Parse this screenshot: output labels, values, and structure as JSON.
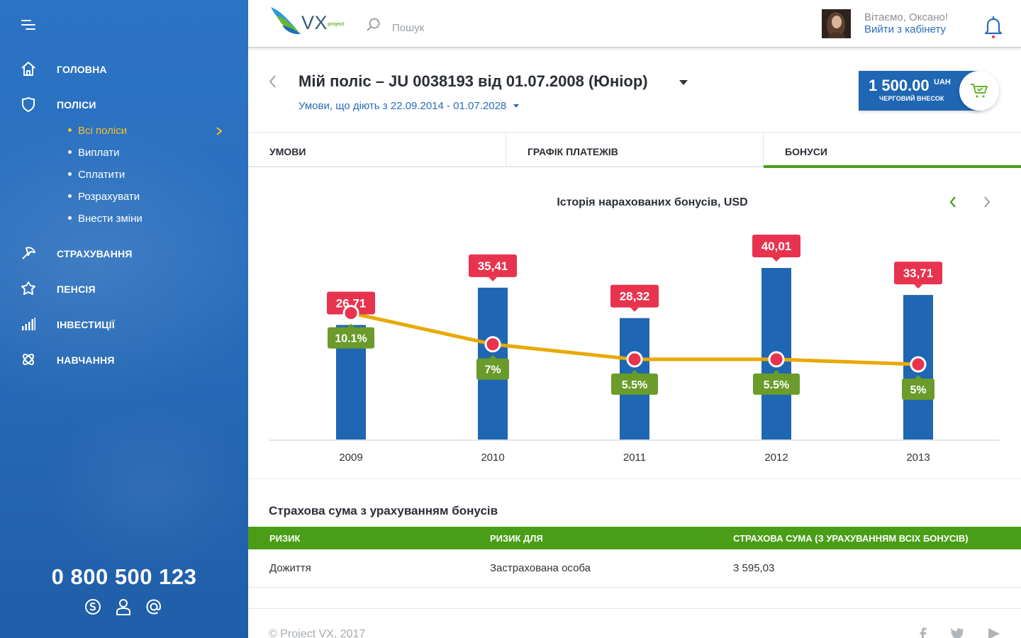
{
  "sidebar": {
    "nav": [
      {
        "label": "ГОЛОВНА",
        "icon": "home-icon"
      },
      {
        "label": "ПОЛІСИ",
        "icon": "shield-icon"
      },
      {
        "label": "СТРАХУВАННЯ",
        "icon": "umbrella-icon"
      },
      {
        "label": "ПЕНСІЯ",
        "icon": "flower-icon"
      },
      {
        "label": "ІНВЕСТИЦІЇ",
        "icon": "bar-chart-icon"
      },
      {
        "label": "НАВЧАННЯ",
        "icon": "atom-icon"
      }
    ],
    "sub_items": [
      "Всі поліси",
      "Виплати",
      "Сплатити",
      "Розрахувати",
      "Внести зміни"
    ],
    "active_sub": "Всі поліси",
    "phone": "0 800 500 123",
    "contact_icons": [
      "skype-icon",
      "user-icon",
      "at-icon"
    ]
  },
  "header": {
    "logo_text": "VX",
    "logo_sub": "project",
    "search_placeholder": "Пошук",
    "greeting": "Вітаємо, Оксано!",
    "logout": "Вийти з кабінету"
  },
  "policy": {
    "title": "Мій поліс – JU 0038193 від 01.07.2008 (Юніор)",
    "conditions": "Умови, що діють з 22.09.2014 - 01.07.2028",
    "payment_amount": "1 500.00",
    "payment_currency": "UAH",
    "payment_label": "ЧЕРГОВИЙ ВНЕСОК"
  },
  "tabs": [
    "УМОВИ",
    "ГРАФІК ПЛАТЕЖІВ",
    "БОНУСИ"
  ],
  "active_tab": "БОНУСИ",
  "chart_data": {
    "type": "bar",
    "title": "Історія нарахованих бонусів, USD",
    "categories": [
      "2009",
      "2010",
      "2011",
      "2012",
      "2013"
    ],
    "series": [
      {
        "values": [
          26.71,
          35.41,
          28.32,
          40.01,
          33.71
        ],
        "labels": [
          "26,71",
          "35,41",
          "28,32",
          "40,01",
          "33,71"
        ]
      },
      {
        "values": [
          10.1,
          7,
          5.5,
          5.5,
          5
        ],
        "labels": [
          "10.1%",
          "7%",
          "5.5%",
          "5.5%",
          "5%"
        ]
      }
    ],
    "ylim": [
      0,
      42
    ],
    "grid": false,
    "colors": {
      "bar": "#1f66b3",
      "line": "#e8a900",
      "bar_label": "#e8334e",
      "rate_label": "#6a9b2b",
      "point": "#e8334e"
    }
  },
  "table": {
    "title": "Страхова сума з урахуванням бонусів",
    "headers": [
      "РИЗИК",
      "РИЗИК ДЛЯ",
      "СТРАХОВА СУМА (З УРАХУВАННЯМ ВСІХ БОНУСІВ)"
    ],
    "rows": [
      [
        "Дожиття",
        "Застрахована особа",
        "3 595,03"
      ]
    ]
  },
  "footer": {
    "copyright": "© Project VX, 2017",
    "social": [
      "facebook-icon",
      "twitter-icon",
      "youtube-icon"
    ]
  }
}
